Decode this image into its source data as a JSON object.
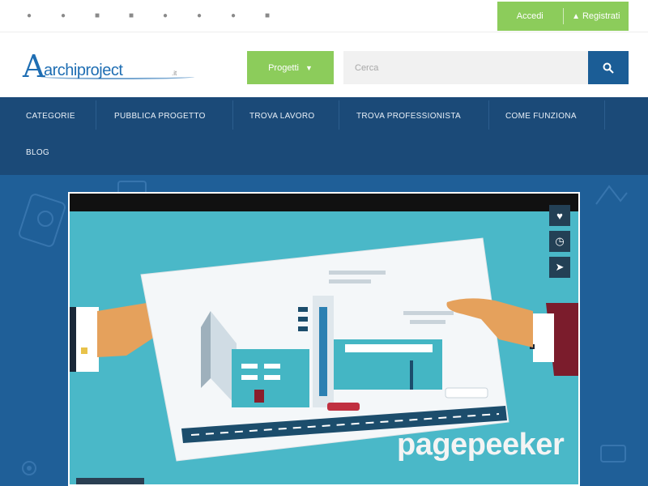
{
  "topbar": {
    "social_icons": [
      "icon-1",
      "icon-2",
      "icon-3",
      "icon-4",
      "icon-5",
      "icon-6",
      "icon-7",
      "icon-8"
    ],
    "login_label": "Accedi",
    "register_label": "Registrati"
  },
  "header": {
    "logo_text": "archiproject",
    "logo_tld": ".it",
    "category_dropdown_label": "Progetti",
    "search_placeholder": "Cerca"
  },
  "nav": {
    "items": [
      "Categorie",
      "Pubblica progetto",
      "Trova lavoro",
      "Trova professionista",
      "Come funziona",
      "Blog"
    ]
  },
  "hero": {
    "video_controls": [
      "heart-icon",
      "clock-icon",
      "send-icon"
    ]
  },
  "watermark": {
    "text": "pagepeeker"
  },
  "colors": {
    "accent_green": "#8ccc5b",
    "nav_blue": "#1b4a78",
    "hero_blue": "#1f5f98",
    "search_button_blue": "#1b5d96"
  }
}
